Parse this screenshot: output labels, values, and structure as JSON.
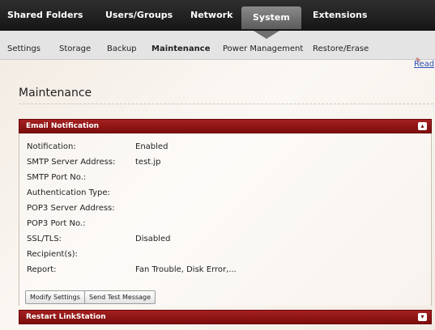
{
  "topnav": {
    "tabs": [
      {
        "label": "Shared Folders"
      },
      {
        "label": "Users/Groups"
      },
      {
        "label": "Network"
      },
      {
        "label": "System"
      },
      {
        "label": "Extensions"
      }
    ]
  },
  "subnav": {
    "items": [
      {
        "label": "Settings"
      },
      {
        "label": "Storage"
      },
      {
        "label": "Backup"
      },
      {
        "label": "Maintenance"
      },
      {
        "label": "Power Management"
      },
      {
        "label": "Restore/Erase"
      }
    ]
  },
  "help": {
    "label": "Read"
  },
  "page": {
    "title": "Maintenance"
  },
  "email_panel": {
    "title": "Email Notification",
    "rows": [
      {
        "label": "Notification:",
        "value": "Enabled"
      },
      {
        "label": "SMTP Server Address:",
        "value": "test.jp"
      },
      {
        "label": "SMTP Port No.:",
        "value": ""
      },
      {
        "label": "Authentication Type:",
        "value": ""
      },
      {
        "label": "POP3 Server Address:",
        "value": ""
      },
      {
        "label": "POP3 Port No.:",
        "value": ""
      },
      {
        "label": "SSL/TLS:",
        "value": "Disabled"
      },
      {
        "label": "Recipient(s):",
        "value": ""
      },
      {
        "label": "Report:",
        "value": "Fan Trouble, Disk Error,..."
      }
    ],
    "buttons": {
      "modify": "Modify Settings",
      "test": "Send Test Message"
    },
    "toggle_icon": "collapse-icon"
  },
  "restart_panel": {
    "title": "Restart LinkStation",
    "toggle_icon": "expand-icon"
  }
}
